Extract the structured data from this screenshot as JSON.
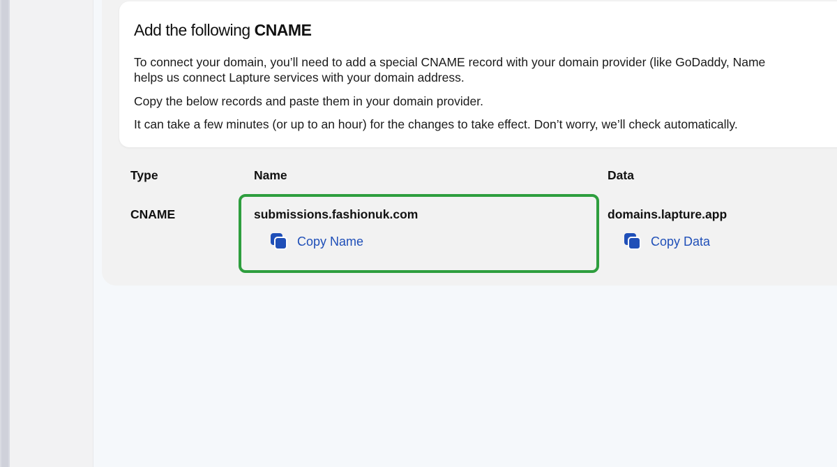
{
  "card": {
    "title_prefix": "Add the following ",
    "title_strong": "CNAME",
    "paragraph_1_line_1": "To connect your domain, you’ll need to add a special CNAME record with your domain provider (like GoDaddy, Name",
    "paragraph_1_line_2": "helps us connect Lapture services with your domain address.",
    "paragraph_2": "Copy the below records and paste them in your domain provider.",
    "paragraph_3": "It can take a few minutes (or up to an hour) for the changes to take effect. Don’t worry, we’ll check automatically."
  },
  "table": {
    "headers": {
      "type": "Type",
      "name": "Name",
      "data": "Data"
    },
    "row": {
      "type": "CNAME",
      "name": "submissions.fashionuk.com",
      "data": "domains.lapture.app",
      "copy_name_label": "Copy Name",
      "copy_data_label": "Copy Data"
    }
  },
  "icons": {
    "copy": "copy-icon"
  },
  "colors": {
    "link": "#1f4fb8",
    "highlight": "#2e9e3e"
  }
}
